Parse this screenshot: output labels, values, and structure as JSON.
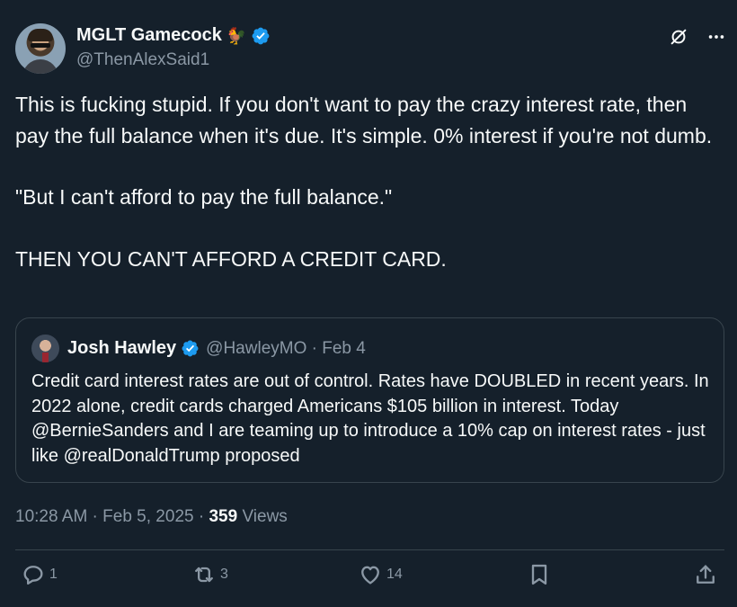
{
  "author": {
    "display_name": "MGLT Gamecock",
    "emoji": "🐓",
    "handle": "@ThenAlexSaid1"
  },
  "tweet": {
    "paragraphs": [
      "This is fucking stupid. If you don't want to pay the crazy interest rate, then pay the full balance when it's due. It's simple. 0% interest if you're not dumb.",
      "\"But I can't afford to pay the full balance.\"",
      "THEN YOU CAN'T AFFORD A CREDIT CARD."
    ]
  },
  "quote": {
    "display_name": "Josh Hawley",
    "handle_date": "@HawleyMO · Feb 4",
    "text": "Credit card interest rates are out of control. Rates have DOUBLED in recent years. In 2022 alone, credit cards charged Americans $105 billion in interest. Today @BernieSanders and I are teaming up to introduce a 10% cap on interest rates - just like @realDonaldTrump proposed"
  },
  "meta": {
    "timestamp": "10:28 AM · Feb 5, 2025 · ",
    "views_count": "359",
    "views_label": " Views"
  },
  "actions": {
    "replies": "1",
    "reposts": "3",
    "likes": "14"
  },
  "icons": {
    "verified": "verified-badge-icon",
    "grok": "grok-icon",
    "more": "more-icon",
    "reply": "reply-icon",
    "repost": "repost-icon",
    "like": "like-icon",
    "bookmark": "bookmark-icon",
    "share": "share-icon"
  },
  "colors": {
    "background": "#15202b",
    "text": "#f7f9f9",
    "muted": "#8b98a5",
    "verified": "#1d9bf0",
    "border": "#38444d"
  }
}
